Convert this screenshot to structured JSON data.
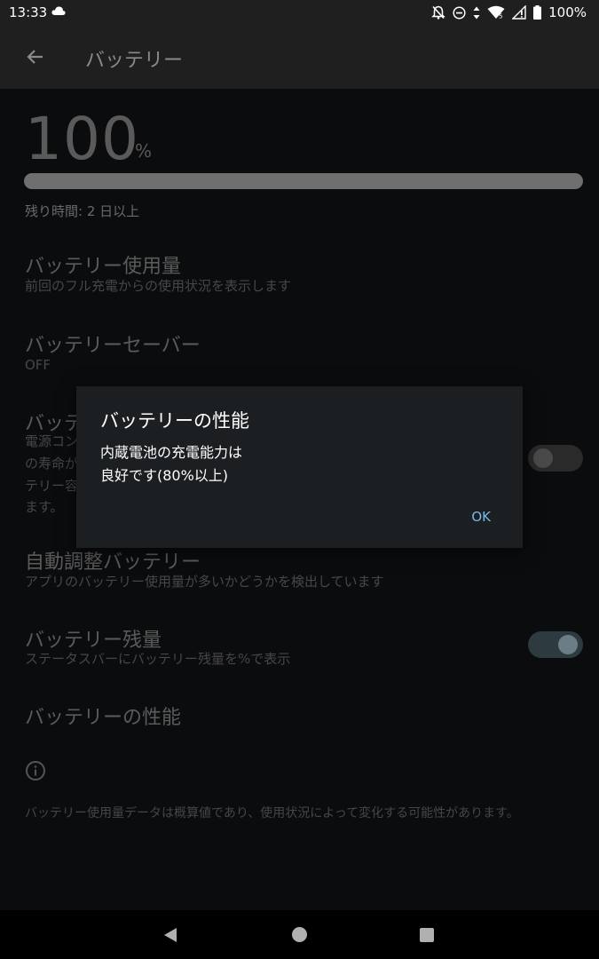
{
  "status_bar": {
    "time": "13:33",
    "battery": "100%",
    "icons": [
      "cloud-icon",
      "notifications-off-icon",
      "do-not-disturb-icon",
      "data-arrows-icon",
      "wifi-icon",
      "signal-icon",
      "battery-icon"
    ]
  },
  "app_bar": {
    "title": "バッテリー"
  },
  "battery": {
    "level_number": "100",
    "level_unit": "%",
    "level_fraction": 1.0,
    "remaining": "残り時間: 2 日以上"
  },
  "items": {
    "usage": {
      "title": "バッテリー使用量",
      "subtitle": "前回のフル充電からの使用状況を表示します"
    },
    "saver": {
      "title": "バッテリーセーバー",
      "subtitle": "OFF"
    },
    "care": {
      "title": "バッテ",
      "lines": [
        "電源コン",
        "の寿命が",
        "テリー容",
        "ます。"
      ],
      "toggle_on": false
    },
    "adaptive": {
      "title": "自動調整バッテリー",
      "subtitle": "アプリのバッテリー使用量が多いかどうかを検出しています"
    },
    "percentage": {
      "title": "バッテリー残量",
      "subtitle": "ステータスバーにバッテリー残量を%で表示",
      "toggle_on": true
    },
    "performance": {
      "title": "バッテリーの性能"
    }
  },
  "footer_note": "バッテリー使用量データは概算値であり、使用状況によって変化する可能性があります。",
  "dialog": {
    "title": "バッテリーの性能",
    "message_line1": "内蔵電池の充電能力は",
    "message_line2": "良好です(80%以上)",
    "ok_label": "OK"
  },
  "colors": {
    "accent": "#7ab8e6",
    "dialog_bg": "#1c1f22",
    "content_bg": "#0b0c0e"
  }
}
